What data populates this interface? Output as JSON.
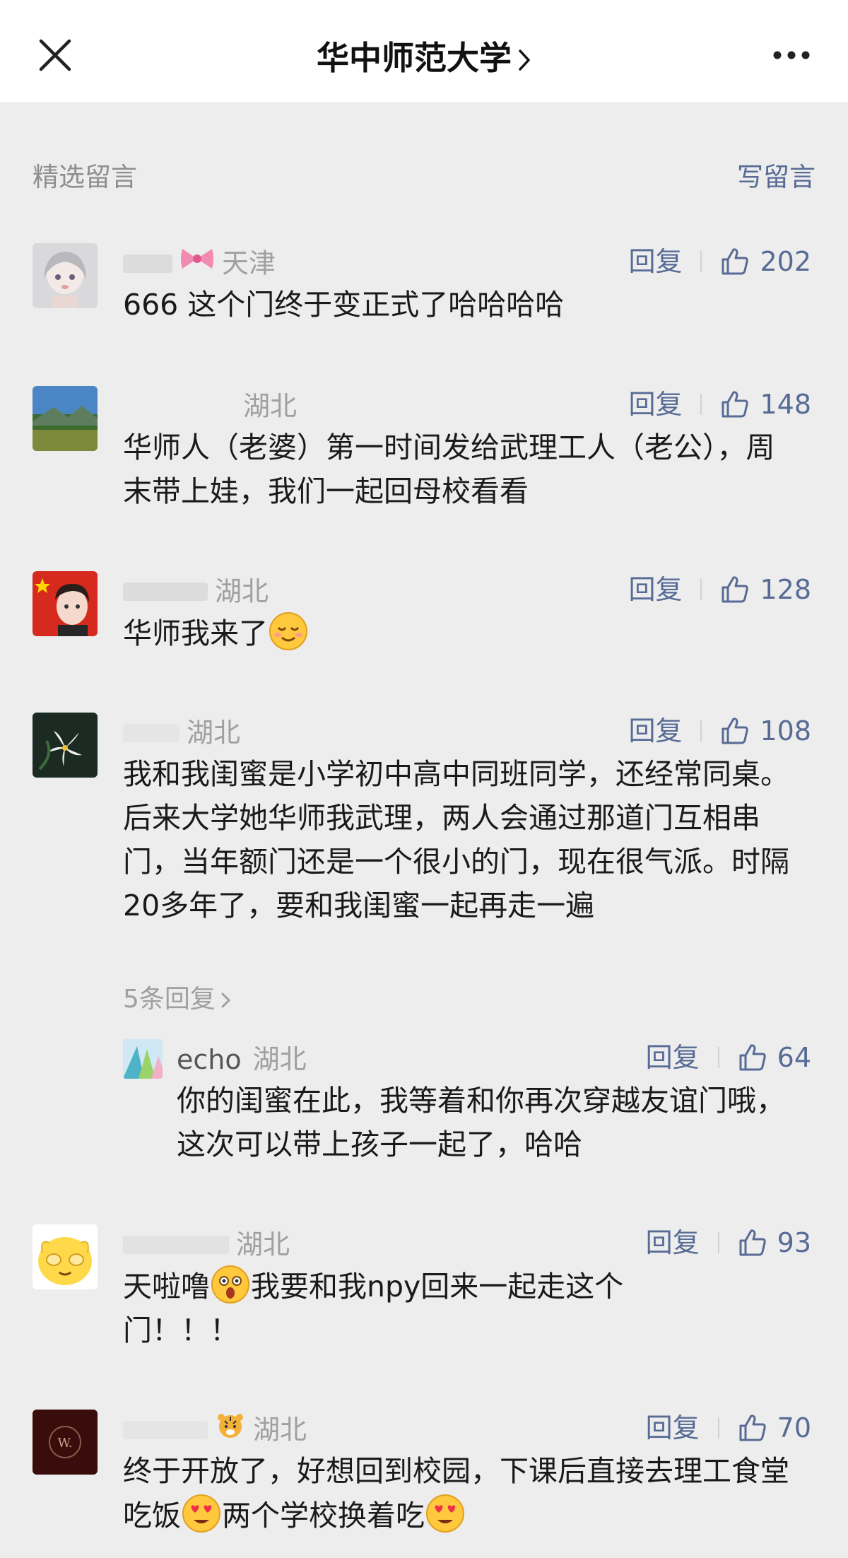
{
  "nav": {
    "title": "华中师范大学",
    "close_icon": "close-icon",
    "more_icon": "more-icon"
  },
  "section": {
    "title": "精选留言",
    "write_label": "写留言"
  },
  "reply_label": "回复",
  "comments": [
    {
      "location": "天津",
      "likes": "202",
      "text": "666 这个门终于变正式了哈哈哈哈"
    },
    {
      "location": "湖北",
      "likes": "148",
      "text": "华师人（老婆）第一时间发给武理工人（老公），周末带上娃，我们一起回母校看看"
    },
    {
      "location": "湖北",
      "likes": "128",
      "text": "华师我来了"
    },
    {
      "location": "湖北",
      "likes": "108",
      "text": "我和我闺蜜是小学初中高中同班同学，还经常同桌。后来大学她华师我武理，两人会通过那道门互相串门，当年额门还是一个很小的门，现在很气派。时隔20多年了，要和我闺蜜一起再走一遍",
      "more_replies": "5条回复"
    },
    {
      "location": "湖北",
      "likes": "93",
      "text_a": "天啦噜",
      "text_b": "我要和我npy回来一起走这个门！！！"
    },
    {
      "location": "湖北",
      "likes": "70",
      "text_a": "终于开放了，好想回到校园，下课后直接去理工食堂吃饭",
      "text_b": "两个学校换着吃"
    }
  ],
  "reply": {
    "nickname": "echo",
    "location": "湖北",
    "likes": "64",
    "text": "你的闺蜜在此，我等着和你再次穿越友谊门哦，这次可以带上孩子一起了，哈哈"
  }
}
